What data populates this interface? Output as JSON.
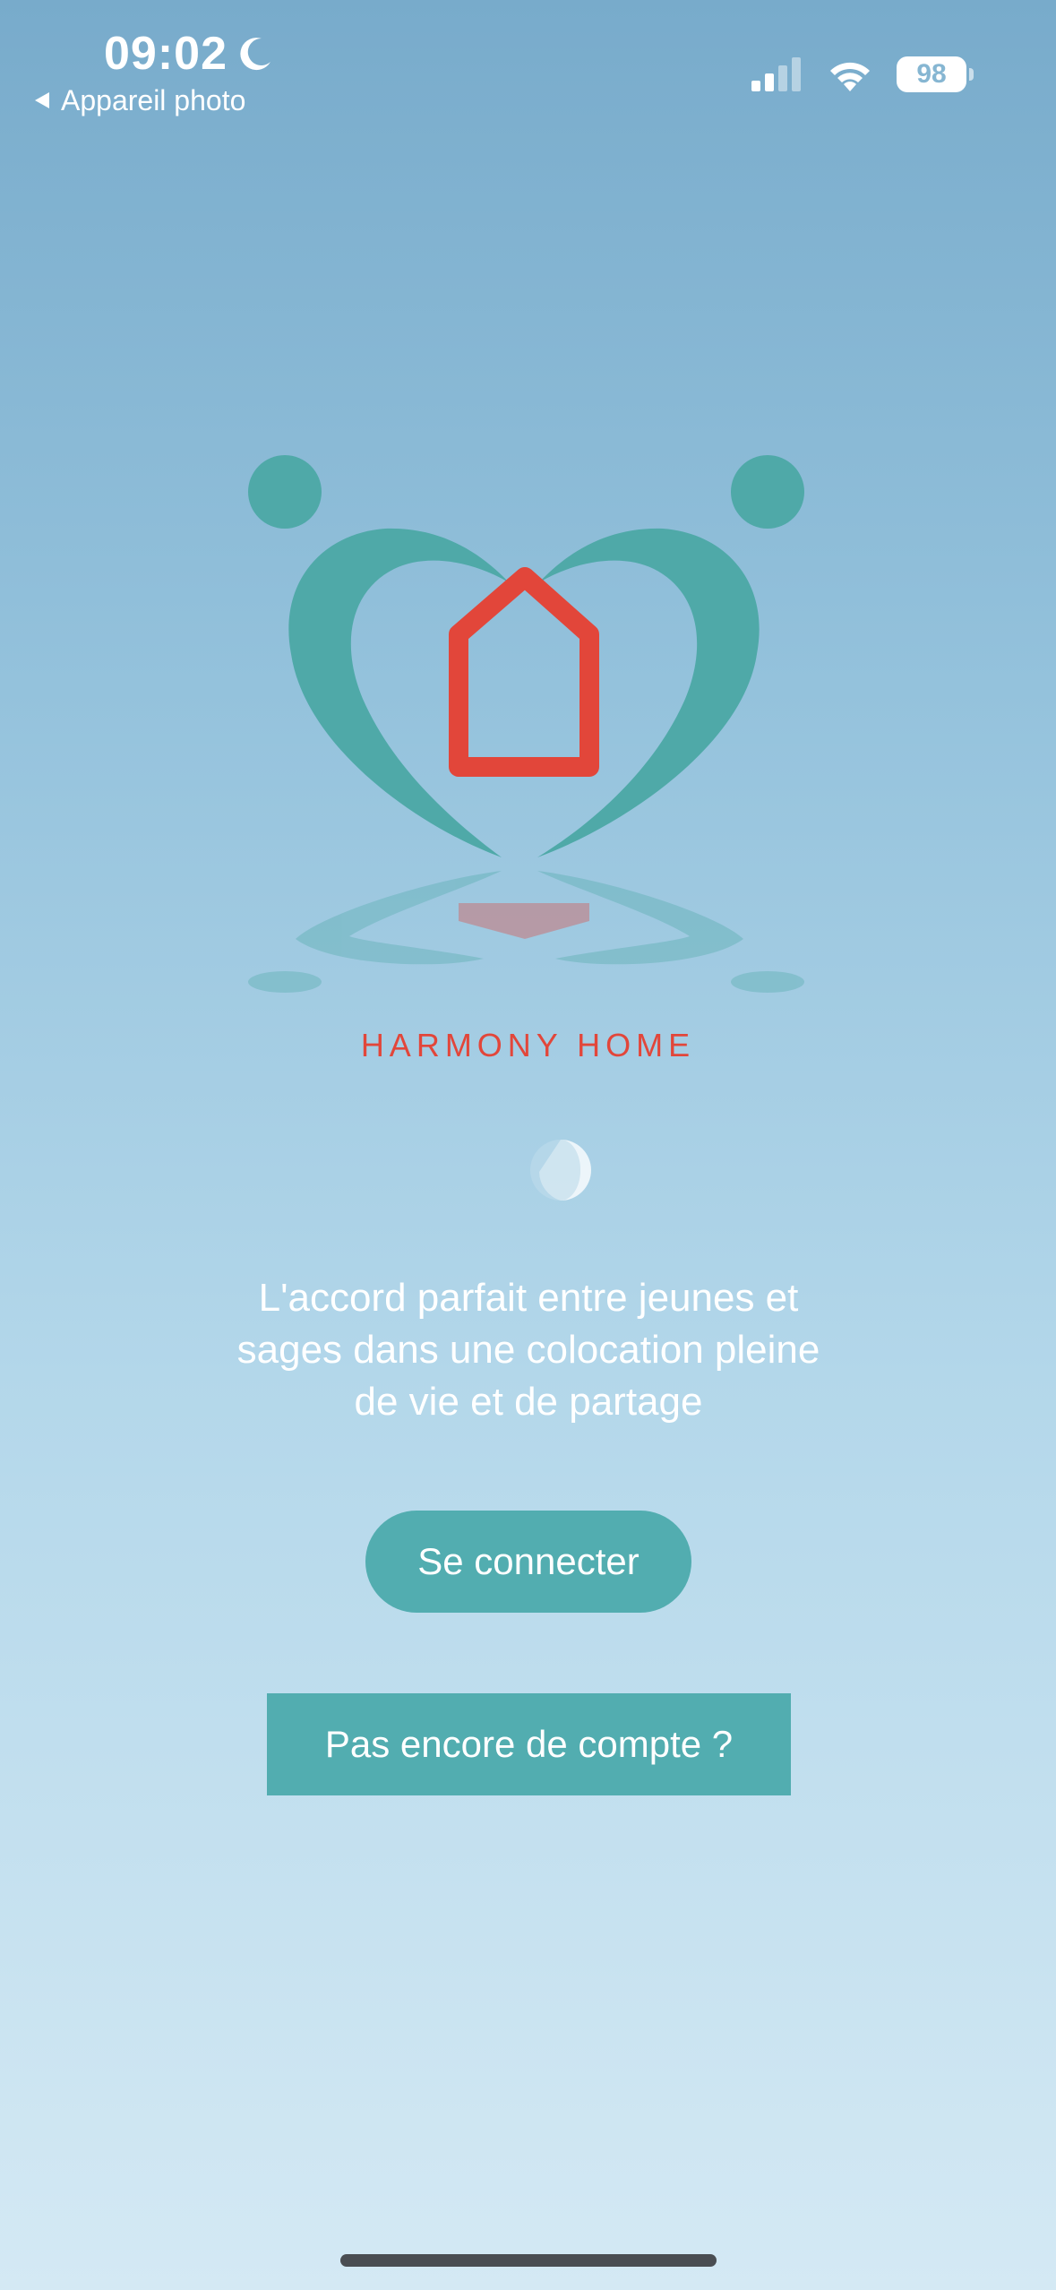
{
  "status_bar": {
    "time": "09:02",
    "back_label": "Appareil photo",
    "battery_level": "98",
    "signal_bars_active": 2,
    "signal_bars_total": 4
  },
  "icons": {
    "moon": "moon-icon",
    "back": "back-arrow-icon",
    "signal": "cellular-signal-icon",
    "wifi": "wifi-icon",
    "battery": "battery-icon",
    "logo": "harmony-home-logo",
    "decor": "moon-decoration-icon"
  },
  "brand": {
    "name": "HARMONY HOME"
  },
  "main": {
    "tagline_line1": "L'accord parfait entre jeunes et",
    "tagline_line2": "sages dans une colocation pleine",
    "tagline_line3": "de vie et de partage",
    "login_label": "Se connecter",
    "signup_label": "Pas encore de compte ?"
  },
  "colors": {
    "accent_teal": "#52adb0",
    "logo_teal": "#4fa9a8",
    "logo_red": "#e2463a",
    "text_white": "#ffffff"
  }
}
